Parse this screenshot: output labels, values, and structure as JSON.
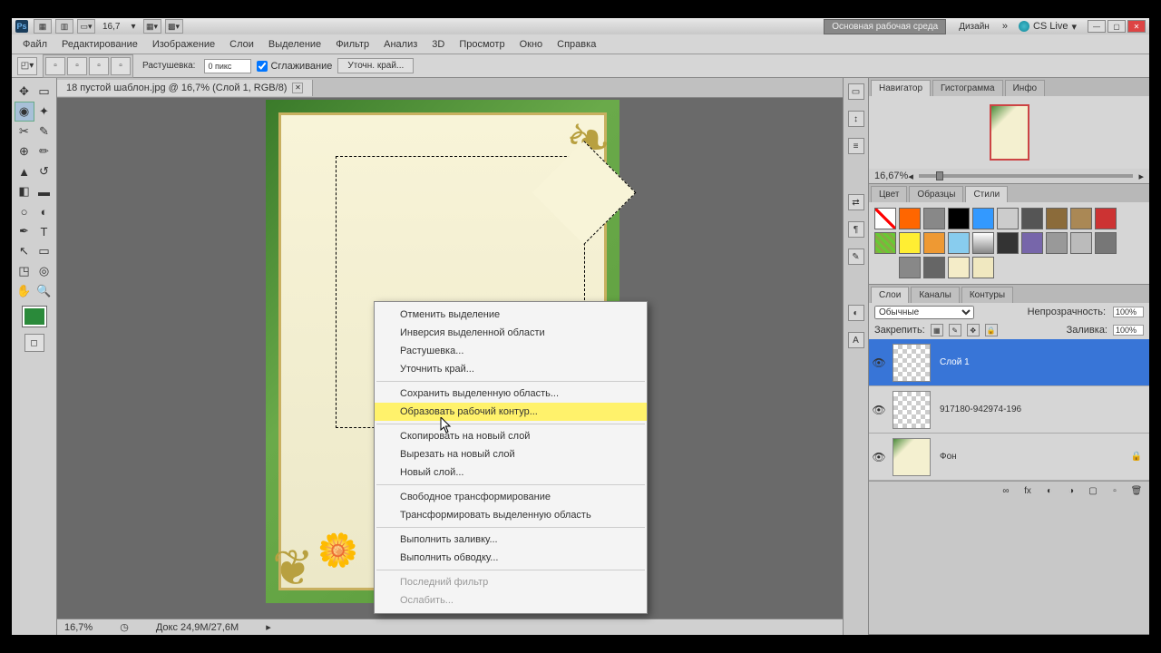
{
  "title": {
    "zoom": "16,7"
  },
  "workspace": {
    "main": "Основная рабочая среда",
    "design": "Дизайн",
    "cslive": "CS Live"
  },
  "menu": [
    "Файл",
    "Редактирование",
    "Изображение",
    "Слои",
    "Выделение",
    "Фильтр",
    "Анализ",
    "3D",
    "Просмотр",
    "Окно",
    "Справка"
  ],
  "options": {
    "feather_label": "Растушевка:",
    "feather_value": "0 пикс",
    "antialias": "Сглаживание",
    "refine": "Уточн. край..."
  },
  "doc": {
    "tab": "18 пустой шаблон.jpg @ 16,7% (Слой 1, RGB/8)"
  },
  "status": {
    "zoom": "16,7%",
    "info": "Докс 24,9М/27,6М"
  },
  "panels": {
    "nav_tabs": [
      "Навигатор",
      "Гистограмма",
      "Инфо"
    ],
    "nav_zoom": "16,67%",
    "color_tabs": [
      "Цвет",
      "Образцы",
      "Стили"
    ],
    "layer_tabs": [
      "Слои",
      "Каналы",
      "Контуры"
    ],
    "blend": "Обычные",
    "opacity_label": "Непрозрачность:",
    "opacity": "100%",
    "lock_label": "Закрепить:",
    "fill_label": "Заливка:",
    "fill": "100%",
    "layers": [
      {
        "name": "Слой 1",
        "sel": true
      },
      {
        "name": "917180-942974-196",
        "sel": false
      },
      {
        "name": "Фон",
        "sel": false,
        "locked": true,
        "bg": true
      }
    ]
  },
  "swatches": [
    "none",
    "#ff6600",
    "#888888",
    "#000000",
    "#3399ff",
    "#cccccc",
    "#555555",
    "#8b6b3a",
    "#aa8855",
    "#cc3333",
    "pat1",
    "#ffee33",
    "#ee9933",
    "#88ccee",
    "grad1",
    "#333333",
    "#7766aa",
    "#999999",
    "#bbbbbb",
    "#777777",
    "",
    "#888888",
    "#666666",
    "#f4ecc8",
    "#f0e8c0"
  ],
  "context": [
    {
      "t": "Отменить выделение"
    },
    {
      "t": "Инверсия выделенной области"
    },
    {
      "t": "Растушевка..."
    },
    {
      "t": "Уточнить край..."
    },
    {
      "sep": true
    },
    {
      "t": "Сохранить выделенную область..."
    },
    {
      "t": "Образовать рабочий контур...",
      "hl": true
    },
    {
      "sep": true
    },
    {
      "t": "Скопировать на новый слой"
    },
    {
      "t": "Вырезать на новый слой"
    },
    {
      "t": "Новый слой..."
    },
    {
      "sep": true
    },
    {
      "t": "Свободное трансформирование"
    },
    {
      "t": "Трансформировать выделенную область"
    },
    {
      "sep": true
    },
    {
      "t": "Выполнить заливку..."
    },
    {
      "t": "Выполнить обводку..."
    },
    {
      "sep": true
    },
    {
      "t": "Последний фильтр",
      "disabled": true
    },
    {
      "t": "Ослабить...",
      "disabled": true
    }
  ]
}
